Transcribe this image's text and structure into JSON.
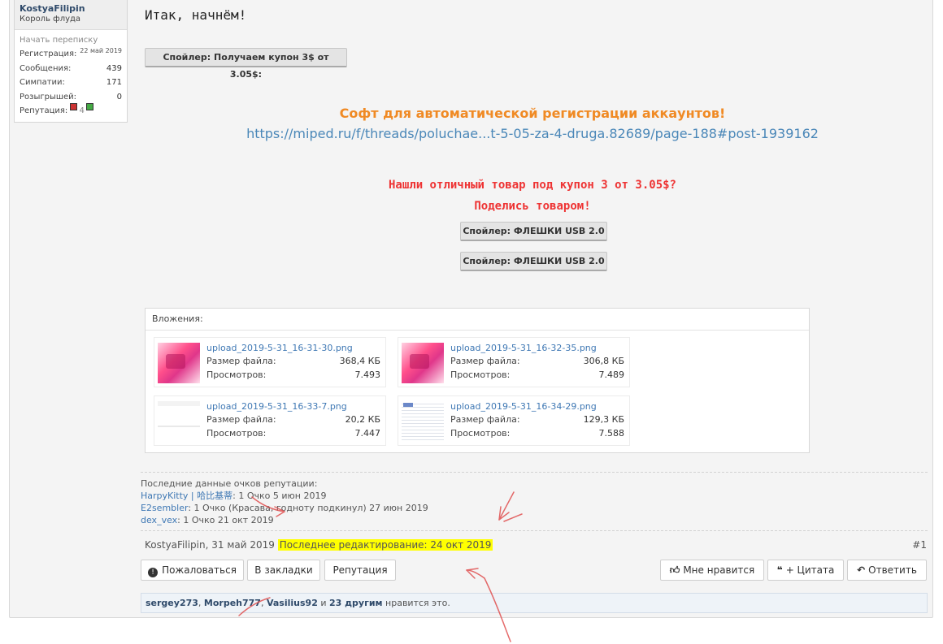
{
  "user": {
    "name": "KostyaFilipin",
    "title": "Король флуда",
    "start_conversation": "Начать переписку",
    "stats": [
      {
        "label": "Регистрация:",
        "value": "22 май 2019"
      },
      {
        "label": "Сообщения:",
        "value": "439"
      },
      {
        "label": "Симпатии:",
        "value": "171"
      },
      {
        "label": "Розыгрышей:",
        "value": "0"
      }
    ],
    "reputation_label": "Репутация:",
    "reputation_value": "4"
  },
  "message": {
    "intro": "Итак, начнём!",
    "spoiler_coupon": "Спойлер: Получаем купон 3$ от 3.05$:",
    "soft_title": "Софт для автоматической регистрации аккаунтов!",
    "soft_link": "https://miped.ru/f/threads/poluchae...t-5-05-za-4-druga.82689/page-188#post-1939162",
    "found_line": "Нашли отличный товар под купон 3 от 3.05$?",
    "share_line": "Поделись товаром!",
    "spoiler_usb_1": "Спойлер: ФЛЕШКИ USB 2.0",
    "spoiler_usb_2": "Спойлер: ФЛЕШКИ USB 2.0"
  },
  "attachments": {
    "header": "Вложения:",
    "size_label": "Размер файла:",
    "views_label": "Просмотров:",
    "items": [
      {
        "name": "upload_2019-5-31_16-31-30.png",
        "size": "368,4 КБ",
        "views": "7.493"
      },
      {
        "name": "upload_2019-5-31_16-32-35.png",
        "size": "306,8 КБ",
        "views": "7.489"
      },
      {
        "name": "upload_2019-5-31_16-33-7.png",
        "size": "20,2 КБ",
        "views": "7.447"
      },
      {
        "name": "upload_2019-5-31_16-34-29.png",
        "size": "129,3 КБ",
        "views": "7.588"
      }
    ]
  },
  "reputation": {
    "header": "Последние данные очков репутации:",
    "entries": [
      {
        "who": "HarpyKitty | 哈比基蒂",
        "text": ": 1 Очко 5 июн 2019"
      },
      {
        "who": "E2sembler",
        "text": ": 1 Очко (Красава, годноту подкинул) 27 июн 2019"
      },
      {
        "who": "dex_vex",
        "text": ": 1 Очко 21 окт 2019"
      }
    ]
  },
  "meta": {
    "author_date": "KostyaFilipin, 31 май 2019",
    "last_edit": "Последнее редактирование: 24 окт 2019",
    "post_number": "#1"
  },
  "actions": {
    "report": "Пожаловаться",
    "bookmark": "В закладки",
    "reputation": "Репутация",
    "like": "Мне нравится",
    "quote": "+ Цитата",
    "reply": "Ответить"
  },
  "likes": {
    "user1": "sergey273",
    "user2": "Morpeh777",
    "user3": "Vasilius92",
    "and": "и",
    "others": "23 другим",
    "suffix": "нравится это."
  },
  "colors": {
    "orange_title": "#f08a24",
    "red_text": "#ee3333",
    "link_blue": "#4a87b8",
    "highlight": "#ffff00",
    "arrow_red": "#e05050"
  }
}
